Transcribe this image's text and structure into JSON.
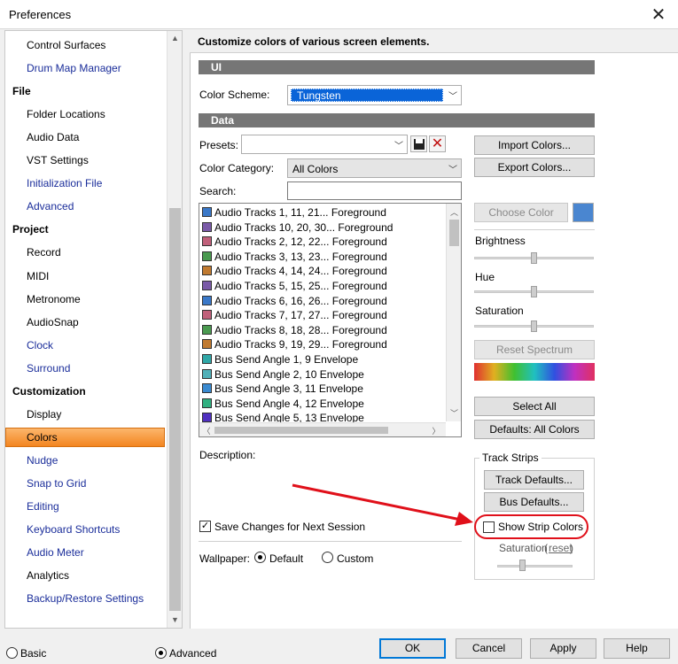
{
  "window": {
    "title": "Preferences",
    "close_glyph": "✕"
  },
  "sidebar": {
    "items": [
      {
        "kind": "item",
        "label": "Control Surfaces",
        "style": "plain"
      },
      {
        "kind": "item",
        "label": "Drum Map Manager",
        "style": "link"
      },
      {
        "kind": "head",
        "label": "File"
      },
      {
        "kind": "item",
        "label": "Folder Locations",
        "style": "plain"
      },
      {
        "kind": "item",
        "label": "Audio Data",
        "style": "plain"
      },
      {
        "kind": "item",
        "label": "VST Settings",
        "style": "plain"
      },
      {
        "kind": "item",
        "label": "Initialization File",
        "style": "link"
      },
      {
        "kind": "item",
        "label": "Advanced",
        "style": "link"
      },
      {
        "kind": "head",
        "label": "Project"
      },
      {
        "kind": "item",
        "label": "Record",
        "style": "plain"
      },
      {
        "kind": "item",
        "label": "MIDI",
        "style": "plain"
      },
      {
        "kind": "item",
        "label": "Metronome",
        "style": "plain"
      },
      {
        "kind": "item",
        "label": "AudioSnap",
        "style": "plain"
      },
      {
        "kind": "item",
        "label": "Clock",
        "style": "link"
      },
      {
        "kind": "item",
        "label": "Surround",
        "style": "link"
      },
      {
        "kind": "head",
        "label": "Customization"
      },
      {
        "kind": "item",
        "label": "Display",
        "style": "plain"
      },
      {
        "kind": "item",
        "label": "Colors",
        "style": "selected"
      },
      {
        "kind": "item",
        "label": "Nudge",
        "style": "link"
      },
      {
        "kind": "item",
        "label": "Snap to Grid",
        "style": "link"
      },
      {
        "kind": "item",
        "label": "Editing",
        "style": "link"
      },
      {
        "kind": "item",
        "label": "Keyboard Shortcuts",
        "style": "link"
      },
      {
        "kind": "item",
        "label": "Audio Meter",
        "style": "link"
      },
      {
        "kind": "item",
        "label": "Analytics",
        "style": "plain"
      },
      {
        "kind": "item",
        "label": "Backup/Restore Settings",
        "style": "link"
      }
    ]
  },
  "header": {
    "title": "Customize colors of various screen elements."
  },
  "ui_section": {
    "title": "UI",
    "color_scheme_label": "Color Scheme:",
    "color_scheme_value": "Tungsten"
  },
  "data_section": {
    "title": "Data",
    "presets_label": "Presets:",
    "presets_value": "",
    "color_category_label": "Color Category:",
    "color_category_value": "All Colors",
    "search_label": "Search:",
    "search_value": ""
  },
  "color_list": [
    {
      "label": "Audio Tracks 1, 11, 21... Foreground",
      "color": "#3a78c8"
    },
    {
      "label": "Audio Tracks 10, 20, 30... Foreground",
      "color": "#7a5aa8"
    },
    {
      "label": "Audio Tracks 2, 12, 22... Foreground",
      "color": "#c0607a"
    },
    {
      "label": "Audio Tracks 3, 13, 23... Foreground",
      "color": "#4a9a50"
    },
    {
      "label": "Audio Tracks 4, 14, 24... Foreground",
      "color": "#c07a30"
    },
    {
      "label": "Audio Tracks 5, 15, 25... Foreground",
      "color": "#7a5aa8"
    },
    {
      "label": "Audio Tracks 6, 16, 26... Foreground",
      "color": "#3a78c8"
    },
    {
      "label": "Audio Tracks 7, 17, 27... Foreground",
      "color": "#c0607a"
    },
    {
      "label": "Audio Tracks 8, 18, 28... Foreground",
      "color": "#4a9a50"
    },
    {
      "label": "Audio Tracks 9, 19, 29... Foreground",
      "color": "#c07a30"
    },
    {
      "label": "Bus Send Angle 1, 9 Envelope",
      "color": "#30a8a8"
    },
    {
      "label": "Bus Send Angle 2, 10 Envelope",
      "color": "#50b0b8"
    },
    {
      "label": "Bus Send Angle 3, 11 Envelope",
      "color": "#3a8ad0"
    },
    {
      "label": "Bus Send Angle 4, 12 Envelope",
      "color": "#30b080"
    },
    {
      "label": "Bus Send Angle 5, 13 Envelope",
      "color": "#5030c0"
    }
  ],
  "right_panel": {
    "import_label": "Import Colors...",
    "export_label": "Export Colors...",
    "choose_color_label": "Choose Color",
    "swatch_color": "#4a86d0",
    "brightness_label": "Brightness",
    "hue_label": "Hue",
    "saturation_label": "Saturation",
    "reset_spectrum_label": "Reset Spectrum",
    "select_all_label": "Select All",
    "defaults_label": "Defaults: All Colors"
  },
  "description_label": "Description:",
  "save_changes": {
    "label": "Save Changes for Next Session",
    "checked": true
  },
  "wallpaper": {
    "label": "Wallpaper:",
    "default_label": "Default",
    "custom_label": "Custom",
    "selected": "Default"
  },
  "track_strips": {
    "title": "Track Strips",
    "track_defaults_label": "Track Defaults...",
    "bus_defaults_label": "Bus Defaults...",
    "show_strip_colors_label": "Show Strip Colors",
    "show_strip_colors_checked": false,
    "saturation_label": "Saturation",
    "reset_label": "reset"
  },
  "annotation": {
    "highlight_color": "#e0101a"
  },
  "footer": {
    "basic_label": "Basic",
    "advanced_label": "Advanced",
    "mode_selected": "Advanced",
    "ok_label": "OK",
    "cancel_label": "Cancel",
    "apply_label": "Apply",
    "help_label": "Help"
  }
}
